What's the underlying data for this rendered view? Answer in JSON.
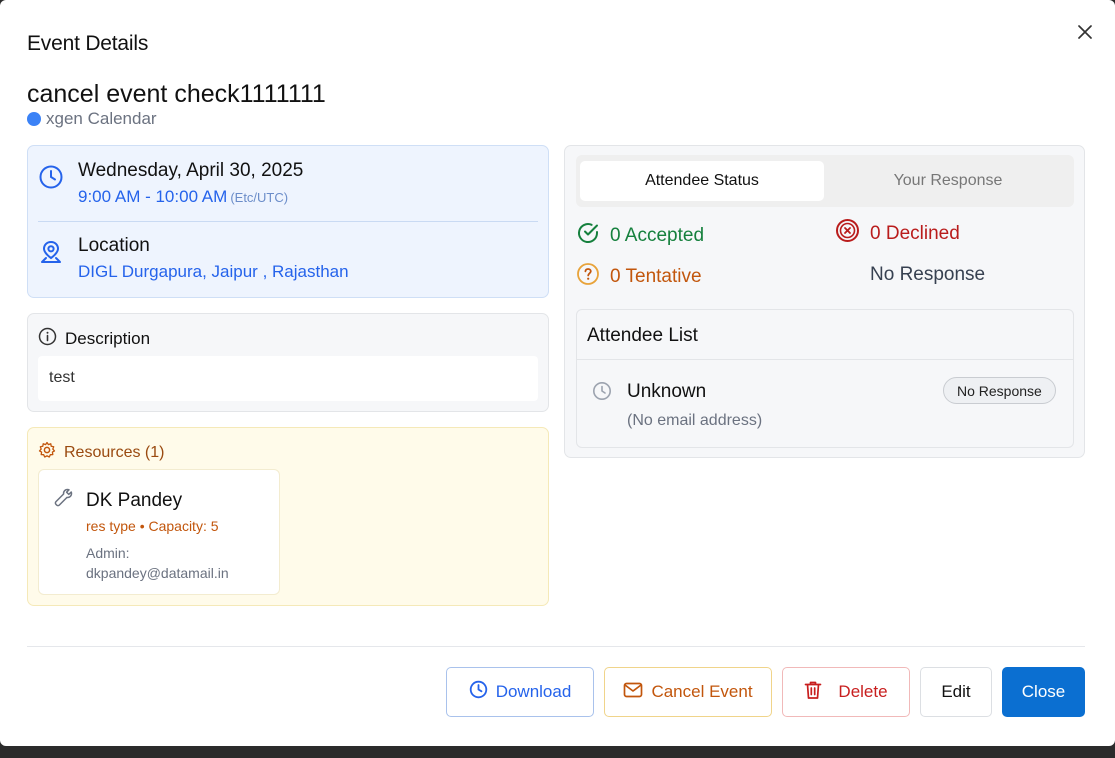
{
  "modal": {
    "title": "Event Details",
    "event_title": "cancel event check1111111",
    "calendar_name": "xgen Calendar",
    "calendar_color": "#3b82f6"
  },
  "datetime": {
    "date": "Wednesday, April 30, 2025",
    "time": "9:00 AM - 10:00 AM",
    "timezone": "(Etc/UTC)"
  },
  "location": {
    "label": "Location",
    "value": "DIGL Durgapura, Jaipur , Rajasthan"
  },
  "description": {
    "label": "Description",
    "text": "test"
  },
  "resources": {
    "label": "Resources (1)",
    "items": [
      {
        "name": "DK Pandey",
        "meta": "res type • Capacity: 5",
        "admin_label": "Admin:",
        "admin_email": "dkpandey@datamail.in"
      }
    ]
  },
  "attendees": {
    "tabs": [
      "Attendee Status",
      "Your Response"
    ],
    "active_tab": "Attendee Status",
    "stats": {
      "accepted": "0 Accepted",
      "declined": "0 Declined",
      "tentative": "0 Tentative",
      "no_response": "No Response"
    },
    "list_title": "Attendee List",
    "list": [
      {
        "name": "Unknown",
        "email": "(No email address)",
        "status": "No Response"
      }
    ]
  },
  "footer": {
    "download": "Download",
    "cancel_event": "Cancel Event",
    "delete": "Delete",
    "edit": "Edit",
    "close": "Close"
  },
  "colors": {
    "primary": "#0b6fd1",
    "accepted": "#15803d",
    "declined": "#b91c1c",
    "tentative": "#c2560c"
  }
}
